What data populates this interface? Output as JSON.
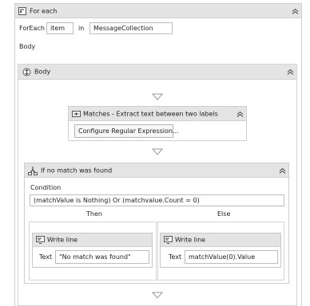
{
  "foreach": {
    "title": "For each",
    "foreach_label": "ForEach",
    "item_value": "item",
    "in_label": "in",
    "collection_value": "MessageCollection",
    "body_label": "Body"
  },
  "body": {
    "title": "Body"
  },
  "matches": {
    "title": "Matches - Extract text between two labels",
    "configure_label": "Configure Regular Expression..."
  },
  "if": {
    "title": "If no match was found",
    "condition_label": "Condition",
    "condition_value": "(matchValue is Nothing) Or (matchvalue.Count = 0)",
    "then_label": "Then",
    "else_label": "Else"
  },
  "then_writeline": {
    "title": "Write line",
    "text_label": "Text",
    "text_value": "\"No match was found\""
  },
  "else_writeline": {
    "title": "Write line",
    "text_label": "Text",
    "text_value": "matchValue(0).Value"
  },
  "icons": [
    "foreach-icon",
    "sequence-icon",
    "matches-icon",
    "if-icon",
    "writeline-icon",
    "collapse-icon",
    "drop-arrow-icon"
  ]
}
